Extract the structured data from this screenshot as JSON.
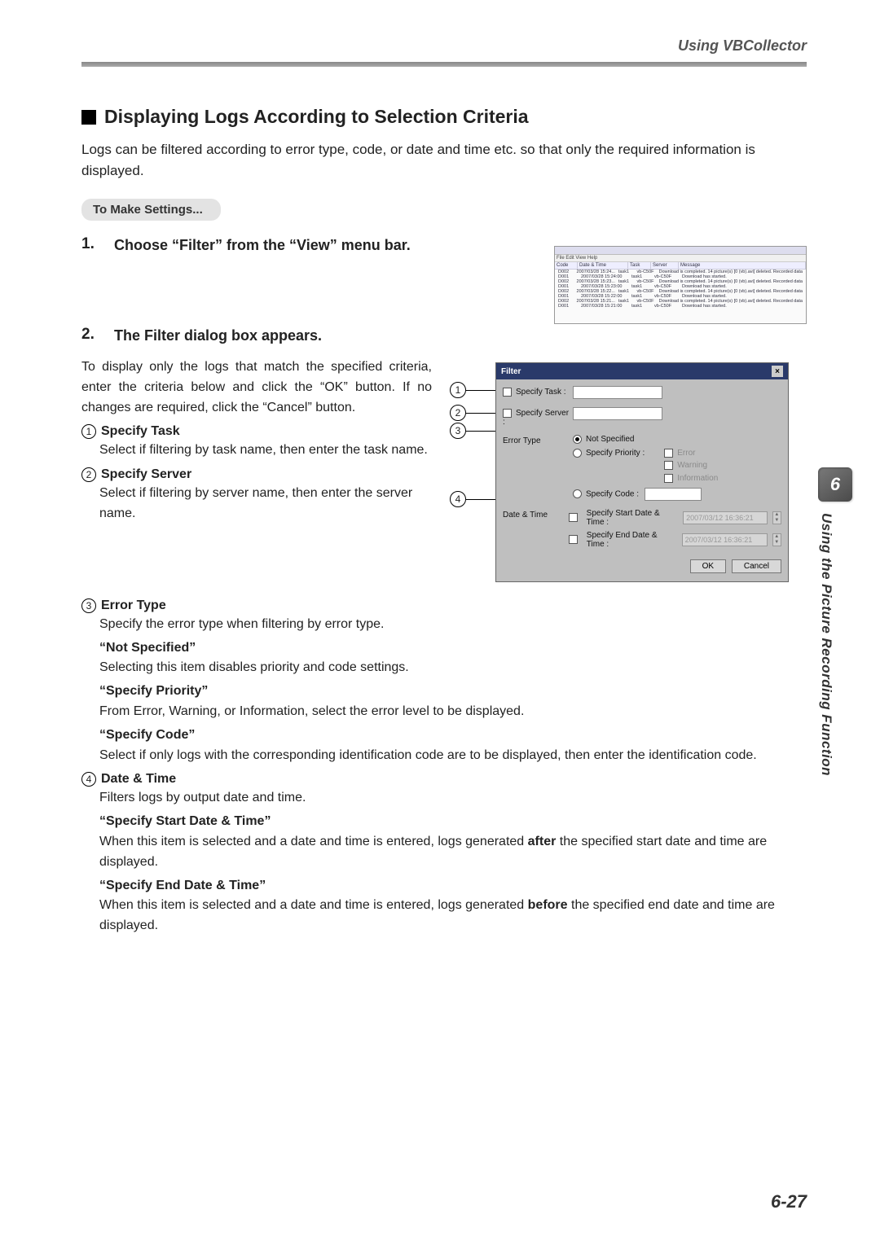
{
  "header": {
    "section": "Using VBCollector"
  },
  "title": "Displaying Logs According to Selection Criteria",
  "lead": "Logs can be filtered according to error type, code, or date and time etc. so that only the required information is displayed.",
  "settings_pill": "To Make Settings...",
  "steps": {
    "s1_num": "1.",
    "s1_text": "Choose “Filter” from the “View” menu bar.",
    "s2_num": "2.",
    "s2_text": "The Filter dialog box appears."
  },
  "para2": "To display only the logs that match the specified criteria, enter the criteria below and click the “OK” button. If no changes are required, click the “Cancel” button.",
  "items": {
    "i1_h": "Specify Task",
    "i1_t": "Select if filtering by task name, then enter the task name.",
    "i2_h": "Specify Server",
    "i2_t": "Select if filtering by server name, then enter the server name.",
    "i3_h": "Error Type",
    "i3_t": "Specify the error type when filtering by error type.",
    "i3_ns_h": "“Not Specified”",
    "i3_ns_t": "Selecting this item disables priority and code settings.",
    "i3_sp_h": "“Specify Priority”",
    "i3_sp_t": "From Error, Warning, or Information, select the error level to be displayed.",
    "i3_sc_h": "“Specify Code”",
    "i3_sc_t": "Select if only logs with the corresponding identification code are to be displayed, then enter the identification code.",
    "i4_h": "Date & Time",
    "i4_t": "Filters logs by output date and time.",
    "i4_sd_h": "“Specify Start Date & Time”",
    "i4_sd_t_a": "When this item is selected and a date and time is entered, logs generated ",
    "i4_sd_bold": "after",
    "i4_sd_t_b": " the specified start date and time are displayed.",
    "i4_ed_h": "“Specify End Date & Time”",
    "i4_ed_t_a": "When this item is selected and a date and time is entered, logs generated ",
    "i4_ed_bold": "before",
    "i4_ed_t_b": " the specified end date and time are displayed."
  },
  "log_window": {
    "menu": "File  Edit  View  Help",
    "cols": {
      "c1": "Code",
      "c2": "Date & Time",
      "c3": "Task",
      "c4": "Server",
      "c5": "Message"
    },
    "rows": [
      {
        "code": "D002",
        "dt": "2007/03/28 15:24...",
        "task": "task1",
        "srv": "vb-C50F",
        "msg": "Download is completed. 14 picture(s) [0 (vb).avi] deleted. Recorded data"
      },
      {
        "code": "D001",
        "dt": "2007/03/28 15:24:00",
        "task": "task1",
        "srv": "vb-C50F",
        "msg": "Download has started."
      },
      {
        "code": "D002",
        "dt": "2007/03/28 15:23...",
        "task": "task1",
        "srv": "vb-C50F",
        "msg": "Download is completed. 14 picture(s) [0 (vb).avi] deleted. Recorded data"
      },
      {
        "code": "D001",
        "dt": "2007/03/28 15:23:00",
        "task": "task1",
        "srv": "vb-C50F",
        "msg": "Download has started."
      },
      {
        "code": "D002",
        "dt": "2007/03/28 15:22...",
        "task": "task1",
        "srv": "vb-C50F",
        "msg": "Download is completed. 14 picture(s) [0 (vb).avi] deleted. Recorded data"
      },
      {
        "code": "D001",
        "dt": "2007/03/28 15:22:00",
        "task": "task1",
        "srv": "vb-C50F",
        "msg": "Download has started."
      },
      {
        "code": "D002",
        "dt": "2007/03/28 15:21...",
        "task": "task1",
        "srv": "vb-C50F",
        "msg": "Download is completed. 14 picture(s) [0 (vb).avi] deleted. Recorded data"
      },
      {
        "code": "D001",
        "dt": "2007/03/28 15:21:00",
        "task": "task1",
        "srv": "vb-C50F",
        "msg": "Download has started."
      }
    ]
  },
  "dlg": {
    "title": "Filter",
    "close": "×",
    "task_lbl": "Specify Task :",
    "server_lbl": "Specify Server :",
    "error_lbl": "Error Type",
    "ns": "Not Specified",
    "sp": "Specify Priority :",
    "pri_e": "Error",
    "pri_w": "Warning",
    "pri_i": "Information",
    "sc": "Specify Code :",
    "dt_lbl": "Date & Time",
    "sd": "Specify Start Date & Time :",
    "ed": "Specify End Date & Time :",
    "date_sample": "2007/03/12 16:36:21",
    "ok": "OK",
    "cancel": "Cancel"
  },
  "side": {
    "chapter": "6",
    "text": "Using the Picture Recording Function"
  },
  "page_num": "6-27",
  "circles": {
    "c1": "1",
    "c2": "2",
    "c3": "3",
    "c4": "4"
  }
}
